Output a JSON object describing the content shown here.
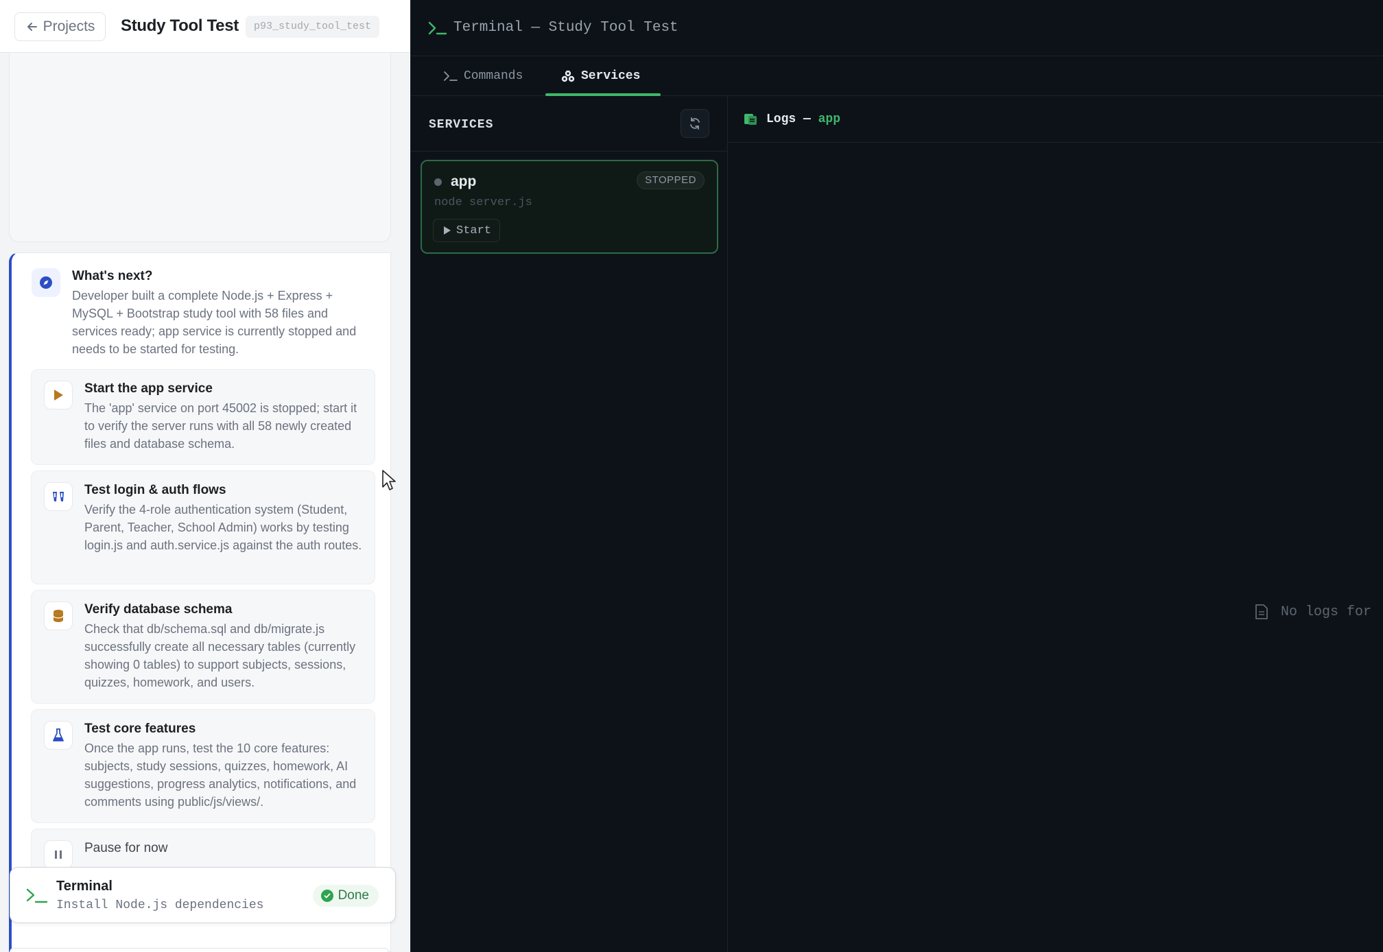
{
  "left": {
    "topbar": {
      "back_label": "Projects",
      "project_title": "Study Tool Test",
      "project_slug": "p93_study_tool_test"
    },
    "next": {
      "title": "What's next?",
      "description": "Developer built a complete Node.js + Express + MySQL + Bootstrap study tool with 58 files and services ready; app service is currently stopped and needs to be started for testing.",
      "actions": [
        {
          "icon": "play-icon",
          "title": "Start the app service",
          "description": "The 'app' service on port 45002 is stopped; start it to verify the server runs with all 58 newly created files and database schema."
        },
        {
          "icon": "users-icon",
          "title": "Test login & auth flows",
          "description": "Verify the 4-role authentication system (Student, Parent, Teacher, School Admin) works by testing login.js and auth.service.js against the auth routes."
        },
        {
          "icon": "database-icon",
          "title": "Verify database schema",
          "description": "Check that db/schema.sql and db/migrate.js successfully create all necessary tables (currently showing 0 tables) to support subjects, sessions, quizzes, homework, and users."
        },
        {
          "icon": "flask-icon",
          "title": "Test core features",
          "description": "Once the app runs, test the 10 core features: subjects, study sessions, quizzes, homework, AI suggestions, progress analytics, notifications, and comments using public/js/views/."
        },
        {
          "icon": "pause-icon",
          "title": "Pause for now",
          "description": ""
        }
      ]
    },
    "terminal_card": {
      "title": "Terminal",
      "command": "Install Node.js dependencies",
      "status": "Done"
    }
  },
  "right": {
    "header_title": "Terminal — Study Tool Test",
    "tabs": [
      {
        "label": "Commands",
        "active": false
      },
      {
        "label": "Services",
        "active": true
      }
    ],
    "services": {
      "heading": "SERVICES",
      "items": [
        {
          "name": "app",
          "status": "STOPPED",
          "command": "node server.js",
          "start_label": "Start"
        }
      ]
    },
    "logs": {
      "title_prefix": "Logs —",
      "service": "app",
      "empty_text": "No logs for"
    }
  },
  "colors": {
    "accent_green": "#3fb86a",
    "accent_blue": "#2d4fc4",
    "terminal_bg": "#0d1218"
  }
}
